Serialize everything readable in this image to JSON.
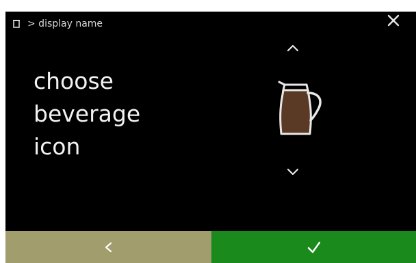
{
  "header": {
    "breadcrumb": "> display name",
    "breadcrumb_icon": "cup-icon",
    "close_icon": "close-icon"
  },
  "main": {
    "title_lines": [
      "choose",
      "beverage",
      "icon"
    ],
    "selected_icon": "coffee-pot-icon",
    "up_icon": "chevron-up-icon",
    "down_icon": "chevron-down-icon"
  },
  "footer": {
    "back_icon": "chevron-left-icon",
    "confirm_icon": "check-icon",
    "back_color": "#a29d6c",
    "confirm_color": "#1a8a1d"
  }
}
